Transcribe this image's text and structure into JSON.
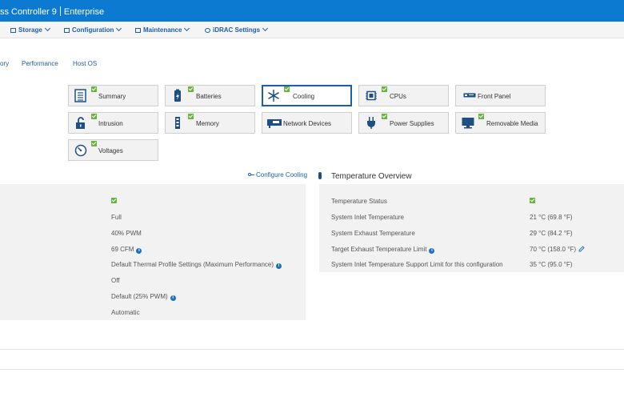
{
  "title": {
    "product": "ss Controller 9",
    "edition": "Enterprise"
  },
  "menu": [
    {
      "label": "Storage",
      "icon": "storage-icon"
    },
    {
      "label": "Configuration",
      "icon": "configuration-icon"
    },
    {
      "label": "Maintenance",
      "icon": "maintenance-icon"
    },
    {
      "label": "iDRAC Settings",
      "icon": "idrac-settings-icon"
    }
  ],
  "tabs": [
    "ory",
    "Performance",
    "Host OS"
  ],
  "tiles": {
    "summary": "Summary",
    "batteries": "Batteries",
    "cooling": "Cooling",
    "cpus": "CPUs",
    "front_panel": "Front Panel",
    "intrusion": "Intrusion",
    "memory": "Memory",
    "network_devices": "Network Devices",
    "power_supplies": "Power Supplies",
    "removable_media": "Removable Media",
    "voltages": "Voltages"
  },
  "configure_link": "Configure Cooling",
  "left_values": [
    "Full",
    "40% PWM",
    "69 CFM",
    "Default Thermal Profile Settings (Maximum Performance)",
    "Off",
    "Default (25% PWM)",
    "Automatic"
  ],
  "temperature": {
    "title": "Temperature Overview",
    "rows": [
      {
        "label": "Temperature Status",
        "value": ""
      },
      {
        "label": "System Inlet Temperature",
        "value": "21 °C (69.8 °F)"
      },
      {
        "label": "System Exhaust Temperature",
        "value": "29 °C (84.2 °F)"
      },
      {
        "label": "Target Exhaust Temperature Limit",
        "value": "70 °C (158.0 °F)"
      },
      {
        "label": "System Inlet Temperature Support Limit for this configuration",
        "value": "35 °C (95.0 °F)"
      }
    ]
  },
  "colors": {
    "header": "#0b7ad0",
    "link": "#1d5fa6",
    "ok": "#69b342",
    "panel": "#f2f2f2"
  },
  "info_glyph": "i"
}
